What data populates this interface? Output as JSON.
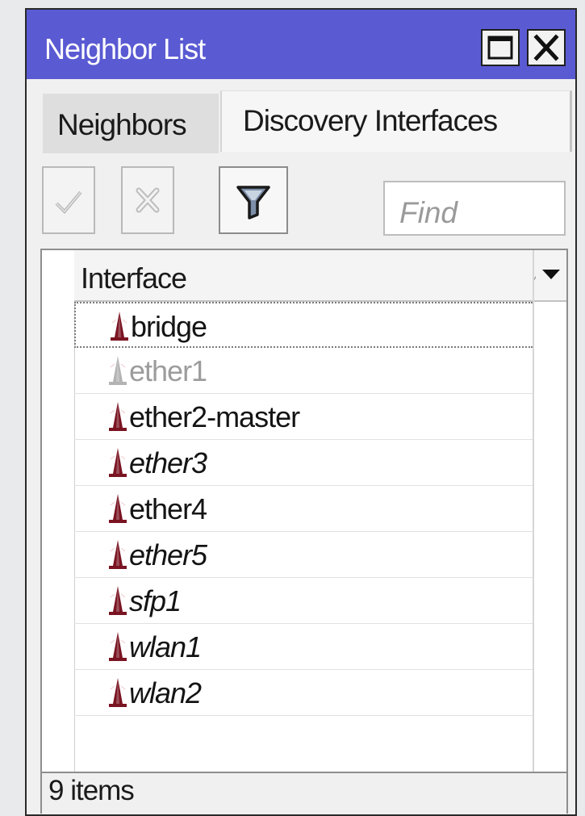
{
  "window": {
    "title": "Neighbor List"
  },
  "tabs": [
    {
      "label": "Neighbors",
      "active": false
    },
    {
      "label": "Discovery Interfaces",
      "active": true
    }
  ],
  "toolbar": {
    "enable_icon": "check-icon",
    "disable_icon": "cross-icon",
    "filter_icon": "funnel-filter-icon",
    "find_placeholder": "Find",
    "find_value": ""
  },
  "table": {
    "columns": [
      {
        "label": "Interface",
        "sort_indicator": "⁄"
      }
    ],
    "rows": [
      {
        "interface": "bridge",
        "state": "normal",
        "italic": false,
        "selected": true
      },
      {
        "interface": "ether1",
        "state": "disabled",
        "italic": false,
        "selected": false
      },
      {
        "interface": "ether2-master",
        "state": "normal",
        "italic": false,
        "selected": false
      },
      {
        "interface": "ether3",
        "state": "normal",
        "italic": true,
        "selected": false
      },
      {
        "interface": "ether4",
        "state": "normal",
        "italic": false,
        "selected": false
      },
      {
        "interface": "ether5",
        "state": "normal",
        "italic": true,
        "selected": false
      },
      {
        "interface": "sfp1",
        "state": "normal",
        "italic": true,
        "selected": false
      },
      {
        "interface": "wlan1",
        "state": "normal",
        "italic": true,
        "selected": false
      },
      {
        "interface": "wlan2",
        "state": "normal",
        "italic": true,
        "selected": false
      }
    ]
  },
  "status": {
    "count_text": "9 items"
  },
  "colors": {
    "titlebar": "#5a5ad3",
    "cone_active": "#7a1422",
    "cone_disabled": "#b3b3b3"
  }
}
